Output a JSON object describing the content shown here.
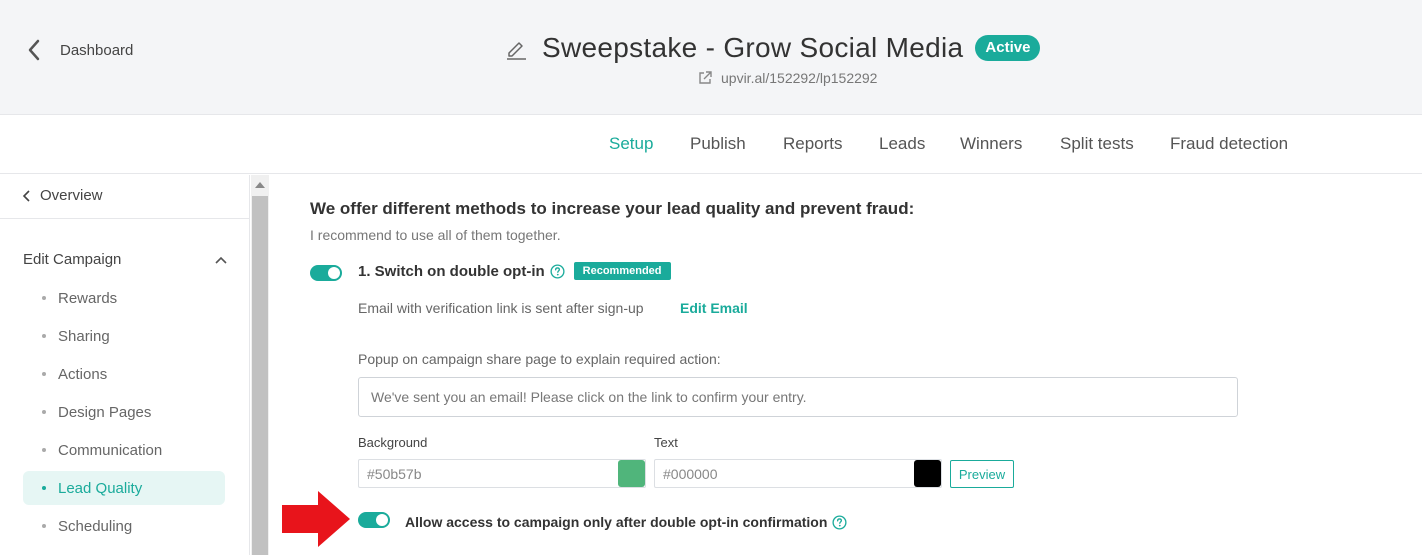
{
  "header": {
    "back_label": "Dashboard",
    "title": "Sweepstake - Grow Social Media",
    "status_badge": "Active",
    "url": "upvir.al/152292/lp152292"
  },
  "tabs": [
    {
      "label": "Setup",
      "active": true
    },
    {
      "label": "Publish"
    },
    {
      "label": "Reports"
    },
    {
      "label": "Leads"
    },
    {
      "label": "Winners"
    },
    {
      "label": "Split tests"
    },
    {
      "label": "Fraud detection"
    }
  ],
  "sidebar": {
    "overview_label": "Overview",
    "section_label": "Edit Campaign",
    "items": [
      {
        "label": "Rewards"
      },
      {
        "label": "Sharing"
      },
      {
        "label": "Actions"
      },
      {
        "label": "Design Pages"
      },
      {
        "label": "Communication"
      },
      {
        "label": "Lead Quality",
        "active": true
      },
      {
        "label": "Scheduling"
      }
    ]
  },
  "main": {
    "heading": "We offer different methods to increase your lead quality and prevent fraud:",
    "subheading": "I recommend to use all of them together.",
    "option1": {
      "label": "1. Switch on double opt-in",
      "badge": "Recommended",
      "enabled": true,
      "email_text": "Email with verification link is sent after sign-up",
      "edit_email_label": "Edit Email",
      "popup_label": "Popup on campaign share page to explain required action:",
      "popup_value": "We've sent you an email! Please click on the link to confirm your entry.",
      "background_label": "Background",
      "background_value": "#50b57b",
      "text_label": "Text",
      "text_value": "#000000",
      "preview_label": "Preview",
      "allow_label": "Allow access to campaign only after double opt-in confirmation",
      "allow_enabled": true
    }
  },
  "colors": {
    "accent": "#1aab9b",
    "background_swatch": "#50b57b",
    "text_swatch": "#000000",
    "arrow": "#e8141b"
  }
}
